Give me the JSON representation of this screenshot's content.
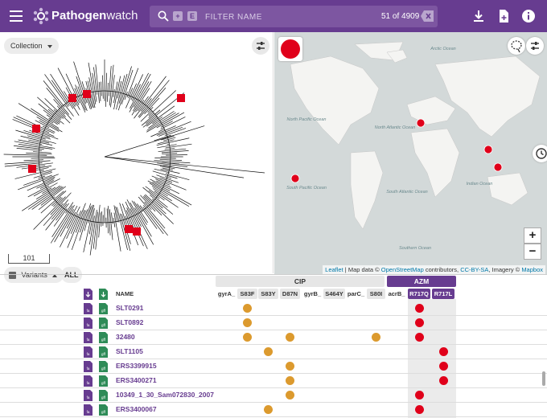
{
  "app": {
    "brand_bold": "Pathogen",
    "brand_thin": "watch"
  },
  "search": {
    "placeholder": "FILTER NAME",
    "count": "51 of 4909",
    "icon_plus": "+",
    "icon_e": "E"
  },
  "tree": {
    "collection_label": "Collection",
    "scale_value": "101",
    "variants_label": "Variants",
    "all_label": "ALL"
  },
  "map": {
    "attribution": {
      "leaflet": "Leaflet",
      "mapdata": " | Map data © ",
      "osm": "OpenStreetMap",
      "contrib": " contributors, ",
      "ccbysa": "CC-BY-SA",
      "imagery": ", Imagery © ",
      "mapbox": "Mapbox"
    },
    "zoom_in": "+",
    "zoom_out": "−",
    "ocean_labels": [
      "Arctic Ocean",
      "North Pacific Ocean",
      "North Atlantic Ocean",
      "South Pacific Ocean",
      "South Atlantic Ocean",
      "Indian Ocean",
      "Southern Ocean"
    ]
  },
  "table": {
    "name_header": "NAME",
    "groups": [
      {
        "label": "CIP",
        "color": "#e6e6e6"
      },
      {
        "label": "AZM",
        "color": "#673c90"
      }
    ],
    "columns": [
      "gyrA_",
      "S83F",
      "S83Y",
      "D87N",
      "gyrB_",
      "S464Y",
      "parC_",
      "S80I",
      "acrB_",
      "R717Q",
      "R717L"
    ],
    "rows": [
      {
        "name": "SLT0291",
        "marks": [
          {
            "col": "S83F",
            "color": "orange"
          },
          {
            "col": "R717Q",
            "color": "red"
          }
        ]
      },
      {
        "name": "SLT0892",
        "marks": [
          {
            "col": "S83F",
            "color": "orange"
          },
          {
            "col": "R717Q",
            "color": "red"
          }
        ]
      },
      {
        "name": "32480",
        "marks": [
          {
            "col": "S83F",
            "color": "orange"
          },
          {
            "col": "D87N",
            "color": "orange"
          },
          {
            "col": "S80I",
            "color": "orange"
          },
          {
            "col": "R717Q",
            "color": "red"
          }
        ]
      },
      {
        "name": "SLT1105",
        "marks": [
          {
            "col": "S83Y",
            "color": "orange"
          },
          {
            "col": "R717L",
            "color": "red"
          }
        ]
      },
      {
        "name": "ERS3399915",
        "marks": [
          {
            "col": "D87N",
            "color": "orange"
          },
          {
            "col": "R717L",
            "color": "red"
          }
        ]
      },
      {
        "name": "ERS3400271",
        "marks": [
          {
            "col": "D87N",
            "color": "orange"
          },
          {
            "col": "R717L",
            "color": "red"
          }
        ]
      },
      {
        "name": "10349_1_30_Sam072830_2007",
        "marks": [
          {
            "col": "D87N",
            "color": "orange"
          },
          {
            "col": "R717Q",
            "color": "red"
          }
        ]
      },
      {
        "name": "ERS3400067",
        "marks": [
          {
            "col": "S83Y",
            "color": "orange"
          },
          {
            "col": "R717Q",
            "color": "red"
          }
        ]
      }
    ]
  },
  "colors": {
    "brand": "#673c90",
    "marker_red": "#e0001a",
    "marker_orange": "#dc9a2e",
    "doc_purple": "#673c90",
    "doc_green": "#2e8b57"
  }
}
